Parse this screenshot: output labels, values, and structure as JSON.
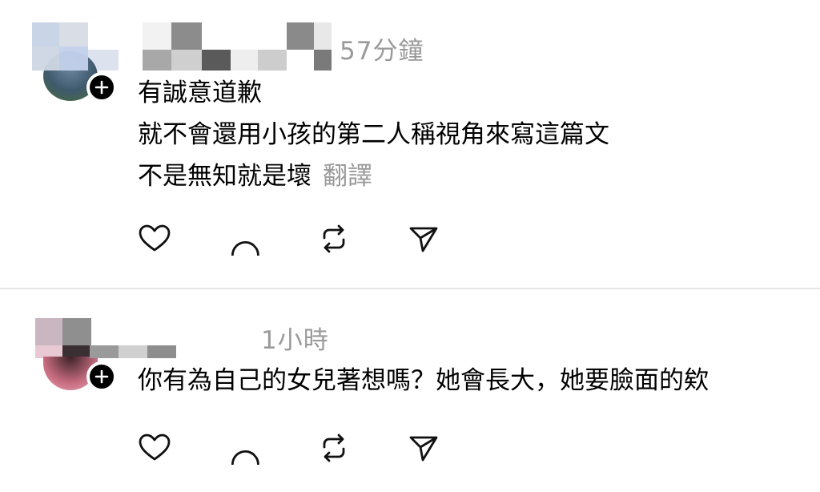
{
  "comments": [
    {
      "timestamp": "57分鐘",
      "lines": [
        "有誠意道歉",
        "就不會還用小孩的第二人稱視角來寫這篇文",
        "不是無知就是壞"
      ],
      "translate_label": "翻譯",
      "actions": [
        "heart-icon",
        "comment-icon",
        "repost-icon",
        "share-icon"
      ]
    },
    {
      "timestamp": "1小時",
      "lines": [
        "你有為自己的女兒著想嗎？她會長大，她要臉面的欸"
      ],
      "actions": [
        "heart-icon",
        "comment-icon",
        "repost-icon",
        "share-icon"
      ]
    }
  ],
  "colors": {
    "text": "#000000",
    "secondary_text": "#9a9a9a",
    "divider": "#e6e6e6",
    "badge": "#000000"
  }
}
